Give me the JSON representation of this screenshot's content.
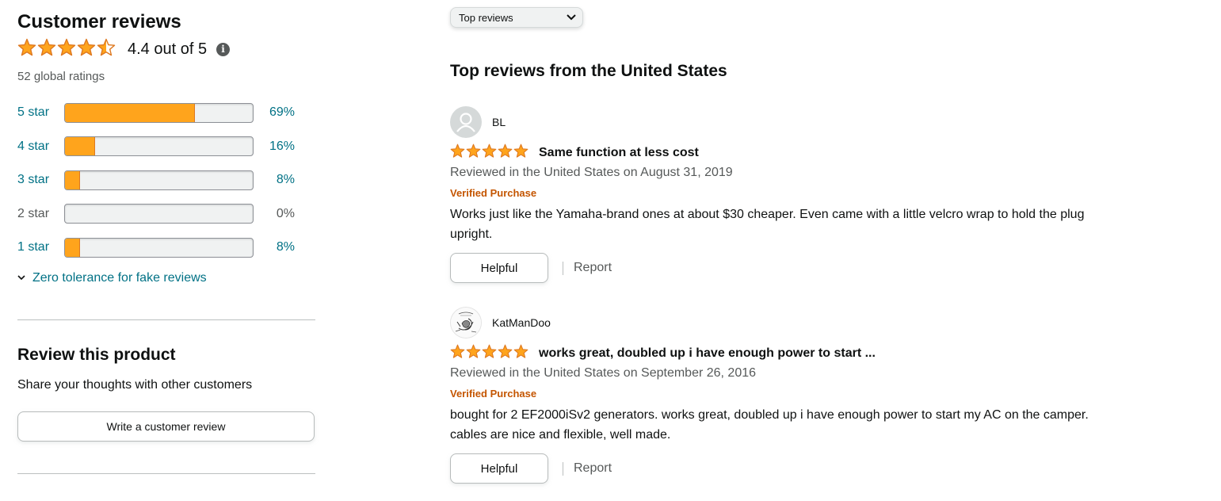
{
  "summary": {
    "title": "Customer reviews",
    "average": "4.4 out of 5",
    "average_value": 4.4,
    "info_icon": "info-icon",
    "global_ratings": "52 global ratings",
    "histogram": [
      {
        "label": "5 star",
        "pct_text": "69%",
        "pct": 69
      },
      {
        "label": "4 star",
        "pct_text": "16%",
        "pct": 16
      },
      {
        "label": "3 star",
        "pct_text": "8%",
        "pct": 8
      },
      {
        "label": "2 star",
        "pct_text": "0%",
        "pct": 0
      },
      {
        "label": "1 star",
        "pct_text": "8%",
        "pct": 8
      }
    ],
    "fake_reviews_link": "Zero tolerance for fake reviews"
  },
  "review_product": {
    "title": "Review this product",
    "subtitle": "Share your thoughts with other customers",
    "button": "Write a customer review"
  },
  "sort": {
    "selected": "Top reviews"
  },
  "reviews_heading": "Top reviews from the United States",
  "reviews": [
    {
      "name": "BL",
      "rating": 5,
      "title": "Same function at less cost",
      "date": "Reviewed in the United States on August 31, 2019",
      "verified": "Verified Purchase",
      "body": "Works just like the Yamaha-brand ones at about $30 cheaper. Even came with a little velcro wrap to hold the plug upright.",
      "helpful": "Helpful",
      "report": "Report"
    },
    {
      "name": "KatManDoo",
      "rating": 5,
      "title": "works great, doubled up i have enough power to start ...",
      "date": "Reviewed in the United States on September 26, 2016",
      "verified": "Verified Purchase",
      "body": "bought for 2 EF2000iSv2 generators. works great, doubled up i have enough power to start my AC on the camper. cables are nice and flexible, well made.",
      "helpful": "Helpful",
      "report": "Report"
    }
  ],
  "colors": {
    "star": "#ffa41c",
    "link": "#007185",
    "verified": "#c45500"
  }
}
